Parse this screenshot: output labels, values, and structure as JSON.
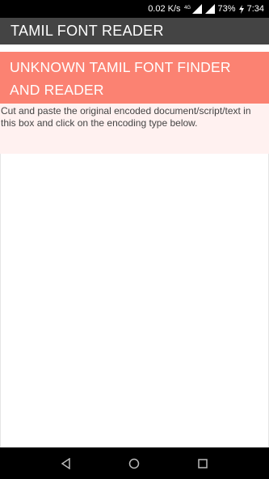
{
  "status_bar": {
    "speed": "0.02 K/s",
    "network": "4G",
    "battery": "73%",
    "time": "7:34"
  },
  "app_bar": {
    "title": "TAMIL FONT READER"
  },
  "banner": {
    "text": "UNKNOWN TAMIL FONT FINDER AND READER"
  },
  "instructions": {
    "text": "Cut and paste the original encoded document/script/text in this box and click on the encoding type below."
  },
  "input": {
    "value": "",
    "placeholder": ""
  },
  "colors": {
    "app_bar": "#444444",
    "banner": "#fb8272",
    "instructions_bg": "#fff1f0"
  },
  "icons": [
    "signal-icon",
    "wifi-icon",
    "battery-charging-icon",
    "back-icon",
    "home-icon",
    "recents-icon"
  ]
}
